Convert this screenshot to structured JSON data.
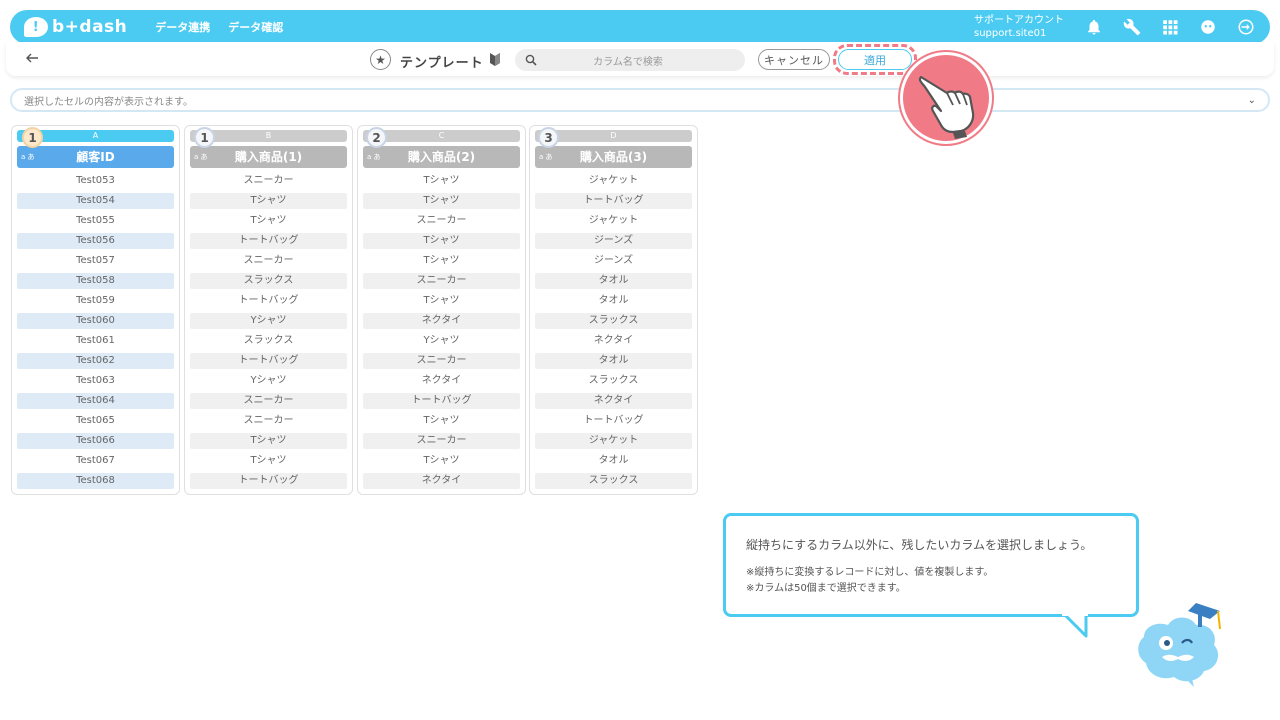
{
  "header": {
    "logo": "b+dash",
    "nav": [
      "データ連携",
      "データ確認"
    ],
    "account_line1": "サポートアカウント",
    "account_line2": "support.site01"
  },
  "toolbar": {
    "title": "テンプレート",
    "search_placeholder": "カラム名で検索",
    "cancel_label": "キャンセル",
    "apply_label": "適用"
  },
  "cell_display": {
    "placeholder": "選択したセルの内容が表示されます。"
  },
  "columns": [
    {
      "letter": "A",
      "badge": "1",
      "type": "a あ",
      "name": "顧客ID",
      "selected": true,
      "rows": [
        "Test053",
        "Test054",
        "Test055",
        "Test056",
        "Test057",
        "Test058",
        "Test059",
        "Test060",
        "Test061",
        "Test062",
        "Test063",
        "Test064",
        "Test065",
        "Test066",
        "Test067",
        "Test068"
      ]
    },
    {
      "letter": "B",
      "badge": "1",
      "type": "a あ",
      "name": "購入商品(1)",
      "selected": false,
      "rows": [
        "スニーカー",
        "Tシャツ",
        "Tシャツ",
        "トートバッグ",
        "スニーカー",
        "スラックス",
        "トートバッグ",
        "Yシャツ",
        "スラックス",
        "トートバッグ",
        "Yシャツ",
        "スニーカー",
        "スニーカー",
        "Tシャツ",
        "Tシャツ",
        "トートバッグ"
      ]
    },
    {
      "letter": "C",
      "badge": "2",
      "type": "a あ",
      "name": "購入商品(2)",
      "selected": false,
      "rows": [
        "Tシャツ",
        "Tシャツ",
        "スニーカー",
        "Tシャツ",
        "Tシャツ",
        "スニーカー",
        "Tシャツ",
        "ネクタイ",
        "Yシャツ",
        "スニーカー",
        "ネクタイ",
        "トートバッグ",
        "Tシャツ",
        "スニーカー",
        "Tシャツ",
        "ネクタイ"
      ]
    },
    {
      "letter": "D",
      "badge": "3",
      "type": "a あ",
      "name": "購入商品(3)",
      "selected": false,
      "rows": [
        "ジャケット",
        "トートバッグ",
        "ジャケット",
        "ジーンズ",
        "ジーンズ",
        "タオル",
        "タオル",
        "スラックス",
        "ネクタイ",
        "タオル",
        "スラックス",
        "ネクタイ",
        "トートバッグ",
        "ジャケット",
        "タオル",
        "スラックス"
      ]
    }
  ],
  "balloon": {
    "main": "縦持ちにするカラム以外に、残したいカラムを選択しましょう。",
    "note1": "※縦持ちに変換するレコードに対し、値を複製します。",
    "note2": "※カラムは50個まで選択できます。"
  },
  "colors": {
    "accent": "#4ccbf2",
    "selected_header": "#5aa9ea",
    "highlight": "#f07b86"
  }
}
